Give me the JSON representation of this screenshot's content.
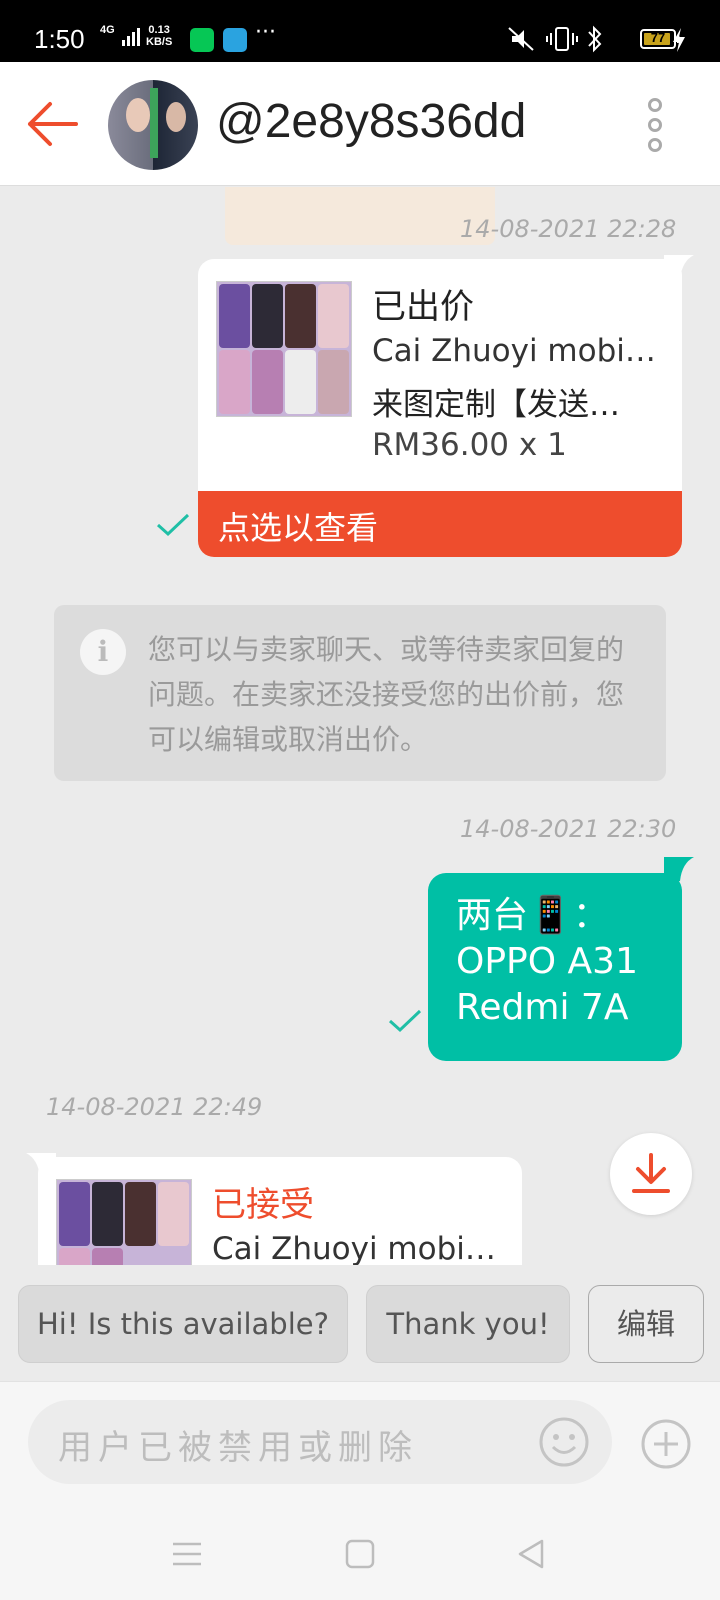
{
  "status_bar": {
    "time": "1:50",
    "network": "4G",
    "speed_value": "0.13",
    "speed_unit": "KB/S",
    "more": "···",
    "battery": "77"
  },
  "header": {
    "username": "@2e8y8s36dd"
  },
  "messages": {
    "ts1": "14-08-2021  22:28",
    "offer_sent": {
      "status": "已出价",
      "line1": "Cai Zhuoyi mobile…",
      "line2": "来图定制【发送…",
      "price": "RM36.00 x 1",
      "cta": "点选以查看"
    },
    "notice": "您可以与卖家聊天、或等待卖家回复的问题。在卖家还没接受您的出价前，您可以编辑或取消出价。",
    "ts2": "14-08-2021  22:30",
    "text_bubble": {
      "line1": "两台📱：",
      "line2": "OPPO A31",
      "line3": "Redmi 7A"
    },
    "ts3": "14-08-2021  22:49",
    "offer_received": {
      "status": "已接受",
      "line1": "Cai Zhuoyi mobile…"
    }
  },
  "quick_replies": [
    "Hi! Is this available?",
    "Thank you!"
  ],
  "edit_label": "编辑",
  "input": {
    "placeholder": "用户已被禁用或删除"
  },
  "colors": {
    "brand": "#ee4d2d",
    "sent_bubble": "#00bfa5",
    "check": "#1fbfa6"
  },
  "icons": [
    "back-arrow-icon",
    "more-vertical-icon",
    "check-icon",
    "info-icon",
    "download-icon",
    "emoji-icon",
    "plus-icon",
    "menu-icon",
    "home-icon",
    "back-icon"
  ]
}
